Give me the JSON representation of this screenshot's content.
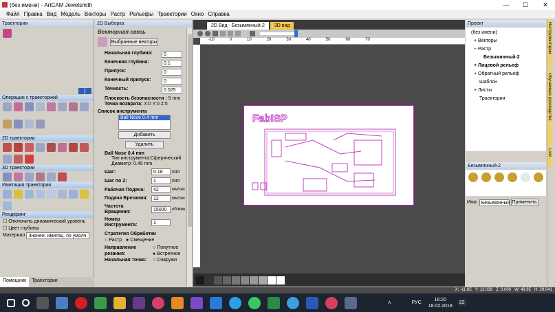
{
  "window": {
    "title": "(без имени) - ArtCAM Jewelsmith"
  },
  "menu": [
    "Файл",
    "Правка",
    "Вид",
    "Модель",
    "Векторы",
    "Растр",
    "Рельефы",
    "Траектории",
    "Окно",
    "Справка"
  ],
  "left": {
    "title": "Траектории",
    "sections": [
      "Операции с траекторией",
      "2D траектории",
      "3D траектории",
      "Имитация траектории",
      "Рендеринг"
    ],
    "options": [
      "Отключить динамический уровень",
      "Цвет глубины"
    ],
    "material_label": "Материал",
    "material_value": "Значен. имитац. по умолч.",
    "tabs": [
      "Помощник",
      "Траектории"
    ]
  },
  "mid": {
    "title": "2D Выборка",
    "heading": "Векторная связь",
    "select_vectors": "Выбранные векторы",
    "fields": [
      {
        "label": "Начальная глубина:",
        "value": "0"
      },
      {
        "label": "Конечная глубина:",
        "value": "0.1"
      },
      {
        "label": "Припуск:",
        "value": "0"
      },
      {
        "label": "Конечный припуск:",
        "value": "0"
      },
      {
        "label": "Точность:",
        "value": "0.025"
      }
    ],
    "safe_plane_label": "Плоскость безопасности :",
    "safe_plane_value": "5 mm",
    "home_label": "Точка возврата:",
    "home_value": "X:0 Y:0 Z:5",
    "tool_list_title": "Список инструмента",
    "tool_item": "Ball Nose 0.4 mm",
    "add_btn": "Добавить",
    "del_btn": "Удалить",
    "tool_name": "Ball Nose 0.4 mm",
    "tool_type_label": "Тип инструмента:",
    "tool_type": "Сферический",
    "diam_label": "Диаметр:",
    "diam": "0.45 mm",
    "params": [
      {
        "label": "Шаг:",
        "value": "0.18",
        "unit": "mm"
      },
      {
        "label": "Шаг по Z:",
        "value": "1",
        "unit": "mm"
      },
      {
        "label": "Рабочая Подача:",
        "value": "42",
        "unit": "мм/сек"
      },
      {
        "label": "Подача Врезания:",
        "value": "12",
        "unit": "мм/сек"
      },
      {
        "label": "Частота Вращения:",
        "value": "15000",
        "unit": "об/мин"
      },
      {
        "label": "Номер Инструмента:",
        "value": "1",
        "unit": ""
      }
    ],
    "strategy_title": "Стратегия Обработки",
    "strategy_opts": [
      "Растр",
      "Смещение"
    ],
    "dir_label": "Направление резания:",
    "dir_opts": [
      "Попутное",
      "Встречное"
    ],
    "start_label": "Начальная точка:",
    "start_opt": "Снаружи"
  },
  "view": {
    "tab_active": "2D Вид - Безымянный-2",
    "tab_inactive": "3D вид",
    "ruler": [
      "-10",
      "0",
      "10",
      "20",
      "30",
      "40",
      "50",
      "60",
      "70"
    ],
    "logo_text": "FabISP"
  },
  "right": {
    "title": "Проект",
    "tree": [
      "(без имени)",
      "Векторы",
      "Растр",
      "Безымянный-2",
      "Лицевой рельеф",
      "Обратный рельеф",
      "Шаблон",
      "Листы",
      "Траектории"
    ],
    "layers_title": "Безымянный-2",
    "name_label": "Имя:",
    "name_value": "Безымянный",
    "apply_btn": "Применить",
    "side_tabs": [
      "Инструментарий",
      "Обучающее руководства",
      "Live!"
    ]
  },
  "status": {
    "x": "X: -11.85",
    "y": "Y: 13.039",
    "z": "Z: 0.000",
    "w": "W: 49.95",
    "h": "H: 29.041"
  },
  "taskbar": {
    "lang": "РУС",
    "time": "16:20",
    "date": "18.02.2019",
    "badge": "22"
  },
  "colors": {
    "accent": "#c020c0",
    "bg_view": "#4a4a4a",
    "panel": "#d4d0c8"
  }
}
